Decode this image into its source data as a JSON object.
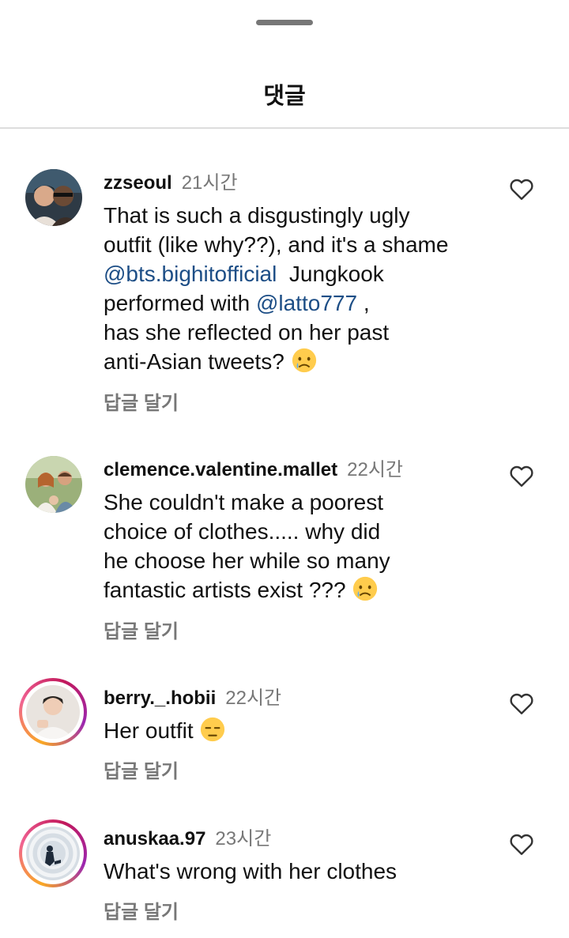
{
  "header": {
    "title": "댓글"
  },
  "comments": [
    {
      "username": "zzseoul",
      "time": "21시간",
      "lines": [
        [
          "That is such a disgustingly ugly"
        ],
        [
          "outfit (like why??), and it's a shame"
        ],
        [
          "@bts.bighitofficial",
          "  Jungkook"
        ],
        [
          "performed with ",
          "@latto777",
          " ,"
        ],
        [
          "has she reflected on her past"
        ],
        [
          "anti-Asian tweets? "
        ]
      ],
      "reply_label": "답글 달기",
      "emoji": "crying-face"
    },
    {
      "username": "clemence.valentine.mallet",
      "time": "22시간",
      "lines": [
        [
          "She couldn't make a poorest"
        ],
        [
          "choice of clothes..... why did"
        ],
        [
          "he choose her while so many"
        ],
        [
          "fantastic artists exist ??? "
        ]
      ],
      "reply_label": "답글 달기",
      "emoji": "crying-face"
    },
    {
      "username": "berry._.hobii",
      "time": "22시간",
      "lines": [
        [
          "Her outfit "
        ]
      ],
      "reply_label": "답글 달기",
      "emoji": "expressionless-face"
    },
    {
      "username": "anuskaa.97",
      "time": "23시간",
      "lines": [
        [
          "What's wrong with her clothes"
        ]
      ],
      "reply_label": "답글 달기"
    }
  ],
  "mentions": [
    "@bts.bighitofficial",
    "@latto777"
  ],
  "colors": {
    "mention": "#1d4e86",
    "secondary_text": "#777777",
    "divider": "#dddddd",
    "story_ring": "#c2185b"
  },
  "icons": [
    "heart-outline-icon",
    "crying-face-emoji",
    "expressionless-face-emoji"
  ]
}
